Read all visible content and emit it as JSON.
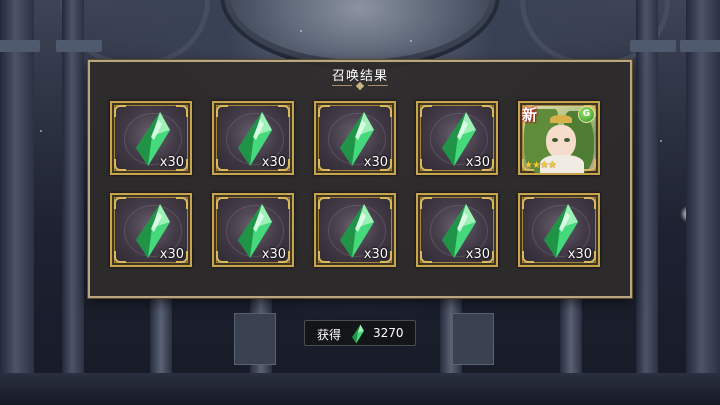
{
  "dialog": {
    "title": "召唤结果"
  },
  "results": [
    {
      "type": "crystal",
      "icon": "green-crystal-icon",
      "quantity": "x30"
    },
    {
      "type": "crystal",
      "icon": "green-crystal-icon",
      "quantity": "x30"
    },
    {
      "type": "crystal",
      "icon": "green-crystal-icon",
      "quantity": "x30"
    },
    {
      "type": "crystal",
      "icon": "green-crystal-icon",
      "quantity": "x30"
    },
    {
      "type": "character",
      "new_label": "新",
      "element": "G",
      "rarity_stars": "★★★★",
      "rarity": 4
    },
    {
      "type": "crystal",
      "icon": "green-crystal-icon",
      "quantity": "x30"
    },
    {
      "type": "crystal",
      "icon": "green-crystal-icon",
      "quantity": "x30"
    },
    {
      "type": "crystal",
      "icon": "green-crystal-icon",
      "quantity": "x30"
    },
    {
      "type": "crystal",
      "icon": "green-crystal-icon",
      "quantity": "x30"
    },
    {
      "type": "crystal",
      "icon": "green-crystal-icon",
      "quantity": "x30"
    }
  ],
  "footer": {
    "label": "获得",
    "icon": "green-crystal-icon",
    "value": "3270"
  },
  "colors": {
    "frame_gold": "#c8a44d",
    "crystal_green": "#3fcf6e",
    "panel_bg": "#2e2a2a"
  }
}
